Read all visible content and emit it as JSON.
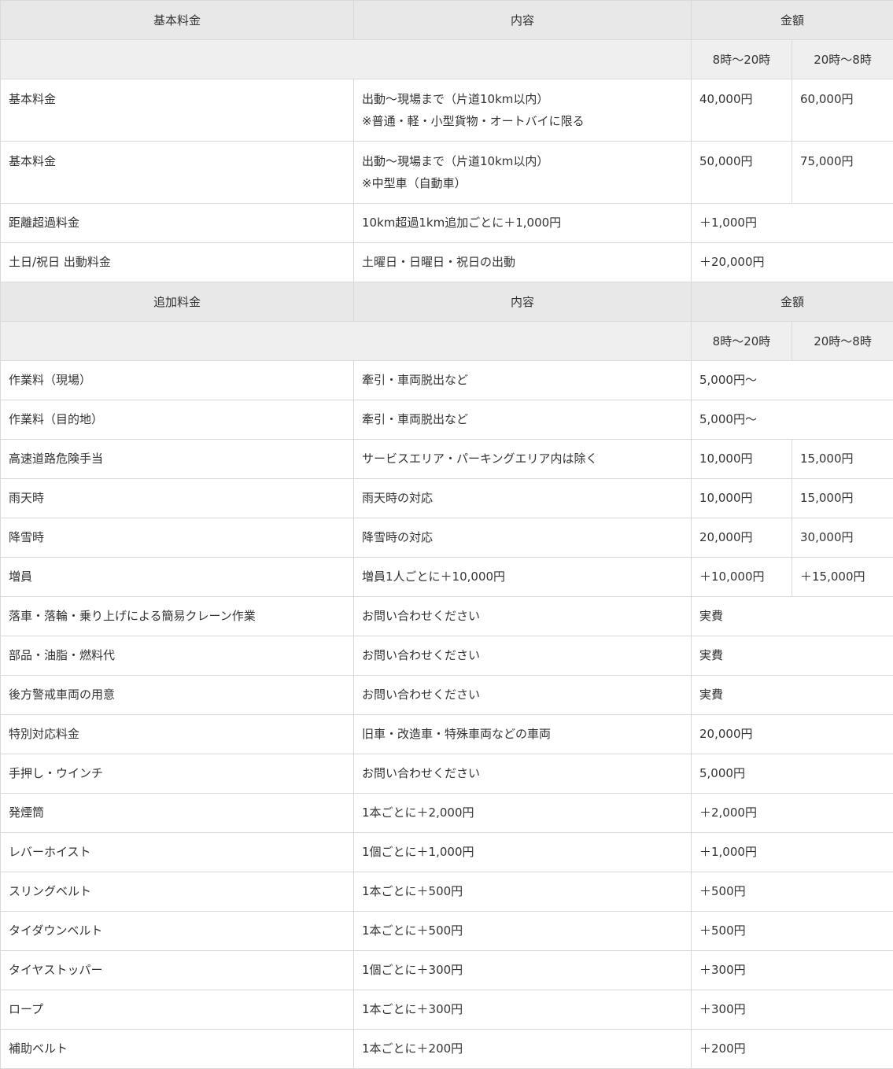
{
  "basic_section": {
    "header": {
      "item": "基本料金",
      "content": "内容",
      "amount": "金額"
    },
    "time_slots": {
      "day": "8時〜20時",
      "night": "20時〜8時"
    },
    "rows": [
      {
        "item": "基本料金",
        "content": "出動〜現場まで（片道10km以内）",
        "note": "※普通・軽・小型貨物・オートバイに限る",
        "day": "40,000円",
        "night": "60,000円"
      },
      {
        "item": "基本料金",
        "content": "出動〜現場まで（片道10km以内）",
        "note": "※中型車（自動車）",
        "day": "50,000円",
        "night": "75,000円"
      },
      {
        "item": "距離超過料金",
        "content": "10km超過1km追加ごとに＋1,000円",
        "amount": "＋1,000円"
      },
      {
        "item": "土日/祝日 出動料金",
        "content": "土曜日・日曜日・祝日の出動",
        "amount": "＋20,000円"
      }
    ]
  },
  "additional_section": {
    "header": {
      "item": "追加料金",
      "content": "内容",
      "amount": "金額"
    },
    "time_slots": {
      "day": "8時〜20時",
      "night": "20時〜8時"
    },
    "rows": [
      {
        "item": "作業料（現場）",
        "content": "牽引・車両脱出など",
        "amount": "5,000円〜"
      },
      {
        "item": "作業料（目的地）",
        "content": "牽引・車両脱出など",
        "amount": "5,000円〜"
      },
      {
        "item": "高速道路危険手当",
        "content": "サービスエリア・パーキングエリア内は除く",
        "day": "10,000円",
        "night": "15,000円"
      },
      {
        "item": "雨天時",
        "content": "雨天時の対応",
        "day": "10,000円",
        "night": "15,000円"
      },
      {
        "item": "降雪時",
        "content": "降雪時の対応",
        "day": "20,000円",
        "night": "30,000円"
      },
      {
        "item": "増員",
        "content": "増員1人ごとに＋10,000円",
        "day": "＋10,000円",
        "night": "＋15,000円"
      },
      {
        "item": "落車・落輪・乗り上げによる簡易クレーン作業",
        "content": "お問い合わせください",
        "amount": "実費"
      },
      {
        "item": "部品・油脂・燃料代",
        "content": "お問い合わせください",
        "amount": "実費"
      },
      {
        "item": "後方警戒車両の用意",
        "content": "お問い合わせください",
        "amount": "実費"
      },
      {
        "item": "特別対応料金",
        "content": "旧車・改造車・特殊車両などの車両",
        "amount": "20,000円"
      },
      {
        "item": "手押し・ウインチ",
        "content": "お問い合わせください",
        "amount": "5,000円"
      },
      {
        "item": "発煙筒",
        "content": "1本ごとに＋2,000円",
        "amount": "＋2,000円"
      },
      {
        "item": "レバーホイスト",
        "content": "1個ごとに＋1,000円",
        "amount": "＋1,000円"
      },
      {
        "item": "スリングベルト",
        "content": "1本ごとに＋500円",
        "amount": "＋500円"
      },
      {
        "item": "タイダウンベルト",
        "content": "1本ごとに＋500円",
        "amount": "＋500円"
      },
      {
        "item": "タイヤストッパー",
        "content": "1個ごとに＋300円",
        "amount": "＋300円"
      },
      {
        "item": "ロープ",
        "content": "1本ごとに＋300円",
        "amount": "＋300円"
      },
      {
        "item": "補助ベルト",
        "content": "1本ごとに＋200円",
        "amount": "＋200円"
      }
    ]
  }
}
